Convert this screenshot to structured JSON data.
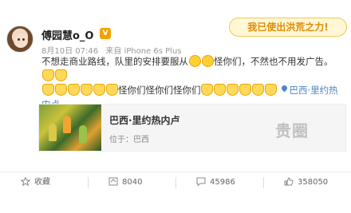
{
  "post": {
    "username": "傅园慧o_O",
    "vip_badge": "V",
    "date": "8月10日 07:46",
    "source": "来自 iPhone 6s Plus",
    "badge_text": "我已使出洪荒之力!",
    "text_line1": "不想走商业路线，队里的安排要服从",
    "text_line1b": "怪你们，不然也不用发广告。",
    "text_line2b": "怪你们怪你们怪你们",
    "location_link": "巴西·里约热",
    "location_link2": "内卢"
  },
  "card": {
    "title": "巴西·里约热内卢",
    "subtitle": "位于：巴西",
    "watermark": "贵圈"
  },
  "actions": {
    "favorite_label": "收藏",
    "repost_count": "8040",
    "comment_count": "45986",
    "like_count": "358050"
  },
  "colors": {
    "link": "#4c86c6",
    "badge": "#e08b00",
    "emoji": "#ffd54a"
  },
  "icons": [
    "star-icon",
    "repost-icon",
    "comment-icon",
    "like-icon",
    "location-icon",
    "cat-emoji-icon",
    "sad-emoji-icon"
  ]
}
